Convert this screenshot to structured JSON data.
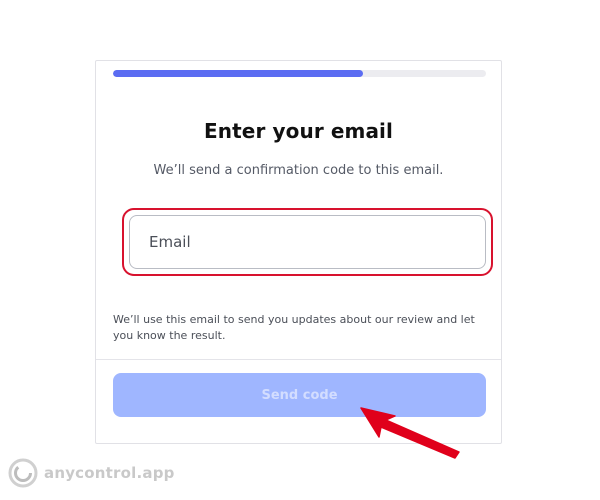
{
  "progress": {
    "fraction": 0.67,
    "fill_color": "#5b6cf2",
    "track_color": "#ececf0"
  },
  "form": {
    "title": "Enter your email",
    "subtitle": "We’ll send a confirmation code to this email.",
    "email_placeholder": "Email",
    "email_value": "",
    "note": "We’ll use this email to send you updates about our review and let you know the result.",
    "send_label": "Send code"
  },
  "annotation": {
    "highlight_color": "#d8122e",
    "arrow_color": "#e0001b",
    "arrow_icon": "pointer-arrow-icon"
  },
  "watermark": {
    "text": "anycontrol.app",
    "icon": "anycontrol-logo-icon"
  },
  "colors": {
    "button_disabled": "#9fb6ff",
    "accent": "#5b6cf2"
  }
}
